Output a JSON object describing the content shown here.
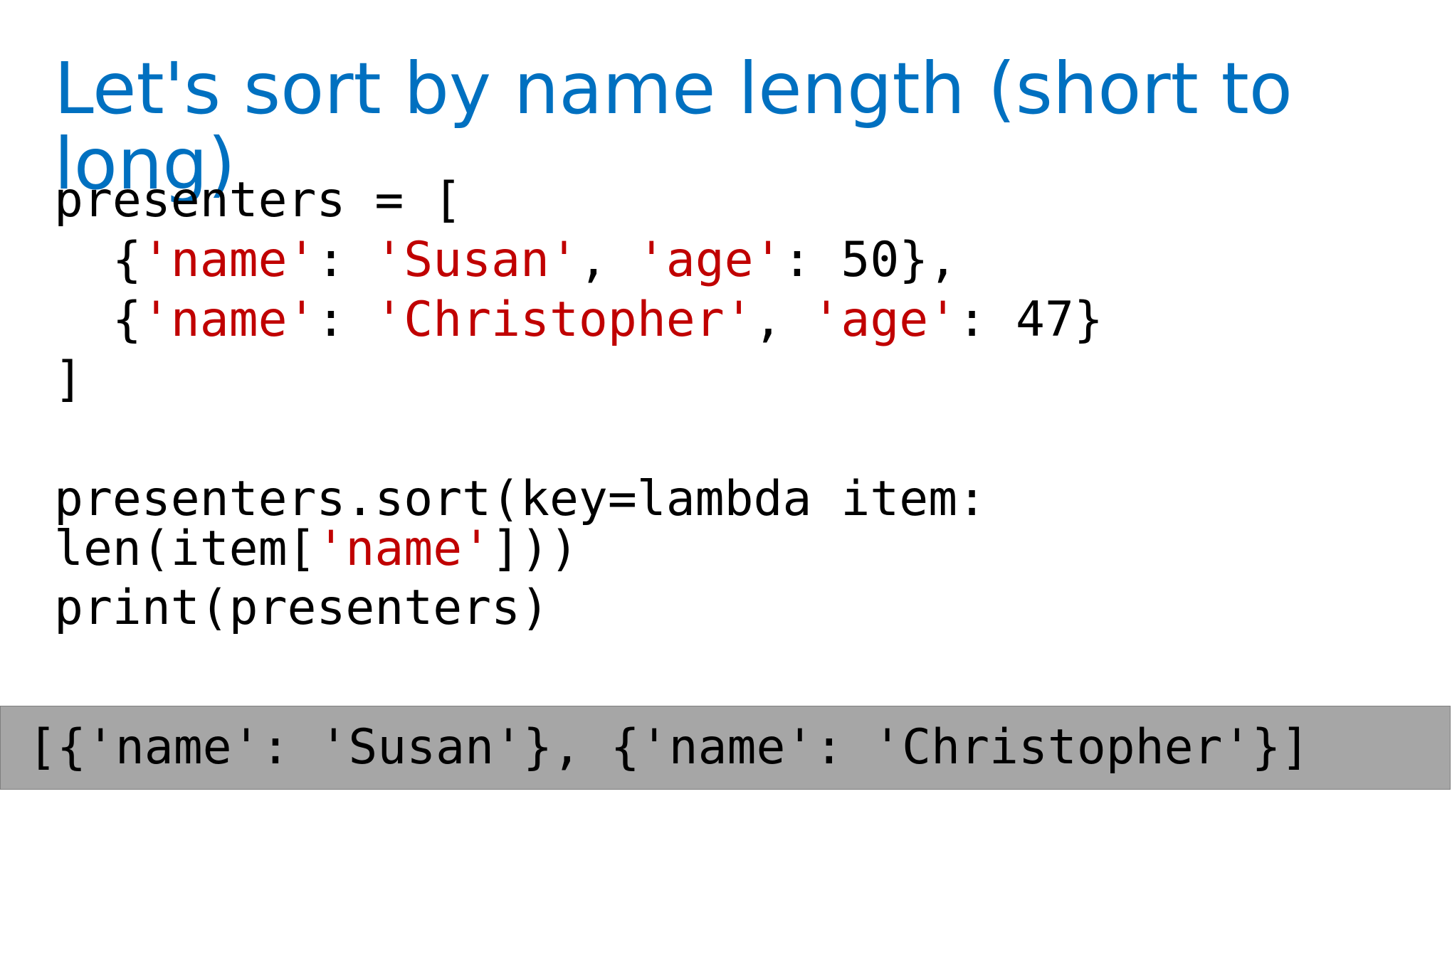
{
  "slide": {
    "title": "Let's sort by name length (short to long)"
  },
  "code": {
    "line1": {
      "t1": "presenters = ["
    },
    "line2": {
      "t1": "  {",
      "s1": "'name'",
      "t2": ": ",
      "s2": "'Susan'",
      "t3": ", ",
      "s3": "'age'",
      "t4": ": 50},"
    },
    "line3": {
      "t1": "  {",
      "s1": "'name'",
      "t2": ": ",
      "s2": "'Christopher'",
      "t3": ", ",
      "s3": "'age'",
      "t4": ": 47}"
    },
    "line4": {
      "t1": "]"
    },
    "line5": {
      "t1": "presenters.sort(key=lambda item:"
    },
    "line6": {
      "t1": "len(item[",
      "s1": "'name'",
      "t2": "]))"
    },
    "line7": {
      "t1": "print(presenters)"
    }
  },
  "output": {
    "text": "[{'name': 'Susan'}, {'name': 'Christopher'}]"
  },
  "colors": {
    "title": "#0070c0",
    "string": "#c00000",
    "output_background": "#a6a6a6"
  }
}
